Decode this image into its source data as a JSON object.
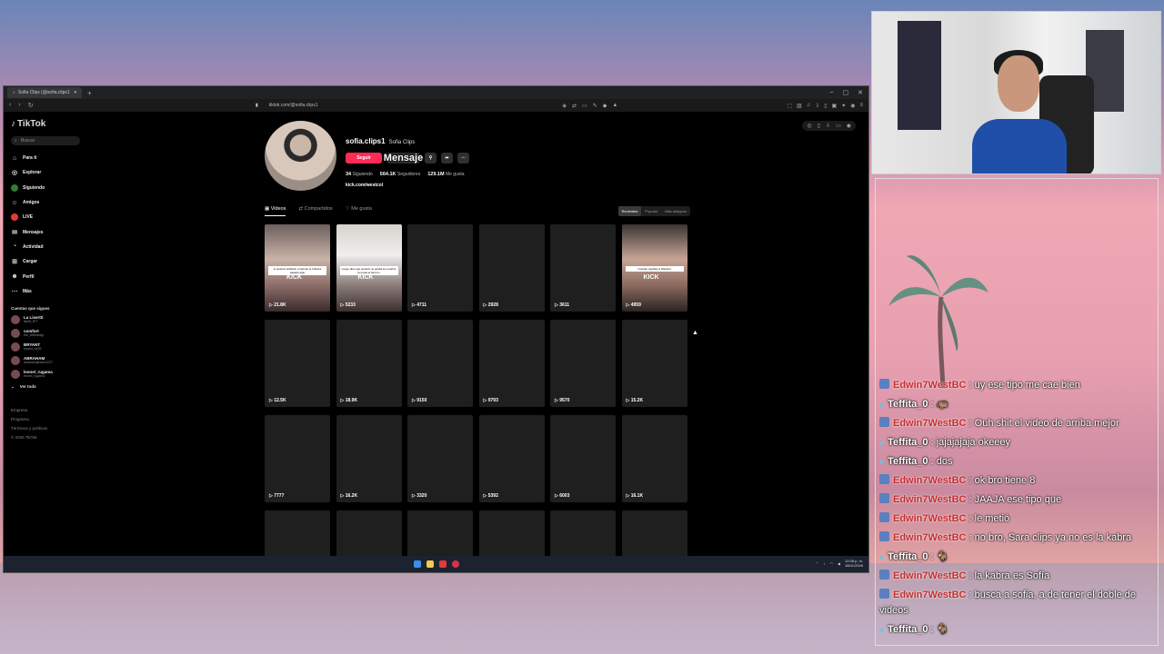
{
  "browser": {
    "tab_title": "Sofia Clips (@sofia.clips1) | TikT...",
    "new_tab": "+",
    "url": "tiktok.com/@sofia.clips1",
    "window_controls": [
      "–",
      "▢",
      "✕"
    ]
  },
  "sidebar": {
    "logo": "TikTok",
    "search_placeholder": "Buscar",
    "nav": [
      {
        "label": "Para ti",
        "icon": "home-icon"
      },
      {
        "label": "Explorar",
        "icon": "compass-icon"
      },
      {
        "label": "Siguiendo",
        "icon": "following-icon"
      },
      {
        "label": "Amigos",
        "icon": "friends-icon"
      },
      {
        "label": "LIVE",
        "icon": "live-icon"
      },
      {
        "label": "Mensajes",
        "icon": "messages-icon"
      },
      {
        "label": "Actividad",
        "icon": "activity-icon"
      },
      {
        "label": "Cargar",
        "icon": "upload-icon"
      },
      {
        "label": "Perfil",
        "icon": "profile-icon"
      },
      {
        "label": "Más",
        "icon": "more-icon"
      }
    ],
    "following_title": "Cuentas que sigues",
    "following": [
      {
        "name": "La Lisertti",
        "handle": "lisetti_ff77"
      },
      {
        "name": "comfort",
        "handle": "the_willinstagr"
      },
      {
        "name": "BRYANT",
        "handle": "bryant_be26"
      },
      {
        "name": "ABRAHAM",
        "handle": "abrahamjansen4227"
      },
      {
        "name": "leonel_rugama",
        "handle": "leonel_rugama"
      }
    ],
    "see_all": "Ver todo",
    "footer": [
      "Empresa",
      "Programa",
      "Términos y políticas",
      "© 2026 TikTok"
    ]
  },
  "profile": {
    "username": "sofia.clips1",
    "display_name": "Sofia Clips",
    "follow_label": "Seguir",
    "message_label": "Mensaje",
    "following_count": "34",
    "following_label": "Siguiendo",
    "followers_count": "564.1K",
    "followers_label": "Seguidores",
    "likes_count": "129.1M",
    "likes_label": "Me gusta",
    "bio_link": "kick.com/westcol"
  },
  "tabs": {
    "videos": "Videos",
    "reposts": "Compartidos",
    "liked": "Me gusta",
    "sort": [
      "Recientes",
      "Popular",
      "Más antiguos"
    ]
  },
  "videos": [
    {
      "views": "21.8K",
      "style": "img1",
      "caption": "lo westcol subtitulo a Garvan le hubiera pasado algo",
      "kick": "KICK"
    },
    {
      "views": "5233",
      "style": "img2",
      "caption": "Luego dice que westcol no acaba los sueños ko pasa el terreno",
      "kick": "KICK"
    },
    {
      "views": "4711"
    },
    {
      "views": "2928"
    },
    {
      "views": "3611"
    },
    {
      "views": "4959",
      "style": "img6",
      "caption": "Cuando regañas a Westcol",
      "kick": "KICK"
    },
    {
      "views": "12.5K"
    },
    {
      "views": "18.9K"
    },
    {
      "views": "9150"
    },
    {
      "views": "9793"
    },
    {
      "views": "9570"
    },
    {
      "views": "15.2K"
    },
    {
      "views": "7777"
    },
    {
      "views": "16.2K"
    },
    {
      "views": "3320"
    },
    {
      "views": "5392"
    },
    {
      "views": "6003"
    },
    {
      "views": "16.1K"
    },
    {
      "views": ""
    },
    {
      "views": ""
    },
    {
      "views": ""
    },
    {
      "views": ""
    },
    {
      "views": ""
    },
    {
      "views": ""
    }
  ],
  "taskbar": {
    "clock_time": "12:08 p. m.",
    "clock_date": "18/01/2026"
  },
  "chat": {
    "messages": [
      {
        "user": "Edwin7WestBC",
        "badge": "robot",
        "text": ": uy ese tipo me cae bien",
        "color": "#c62d2d"
      },
      {
        "user": "Teffita_0",
        "badge": "gem",
        "text": ": 🦛",
        "color": "#ffffff"
      },
      {
        "user": "Edwin7WestBC",
        "badge": "robot",
        "text": ": Ouh shit el video de arriba mejor",
        "color": "#c62d2d"
      },
      {
        "user": "Teffita_0",
        "badge": "gem",
        "text": ": jajajajaja okeeey",
        "color": "#ffffff"
      },
      {
        "user": "Teffita_0",
        "badge": "gem",
        "text": ": dos",
        "color": "#ffffff"
      },
      {
        "user": "Edwin7WestBC",
        "badge": "robot",
        "text": ": ok bro tiene 8",
        "color": "#c62d2d"
      },
      {
        "user": "Edwin7WestBC",
        "badge": "robot",
        "text": ": JAAJA ese tipo que",
        "color": "#c62d2d"
      },
      {
        "user": "Edwin7WestBC",
        "badge": "robot",
        "text": ": le metió",
        "color": "#c62d2d"
      },
      {
        "user": "Edwin7WestBC",
        "badge": "robot",
        "text": ": no bro, Sara clips ya no es la kabra",
        "color": "#c62d2d"
      },
      {
        "user": "Teffita_0",
        "badge": "gem",
        "text": ": 🐐",
        "color": "#ffffff"
      },
      {
        "user": "Edwin7WestBC",
        "badge": "robot",
        "text": ": la kabra es Sofía",
        "color": "#c62d2d"
      },
      {
        "user": "Edwin7WestBC",
        "badge": "robot",
        "text": ": busca a sofia, a de tener el doble de videos",
        "color": "#c62d2d"
      },
      {
        "user": "Teffita_0",
        "badge": "gem",
        "text": ": 🐐",
        "color": "#ffffff"
      }
    ]
  },
  "colors": {
    "accent": "#fe2c55",
    "page_bg": "#000000"
  }
}
